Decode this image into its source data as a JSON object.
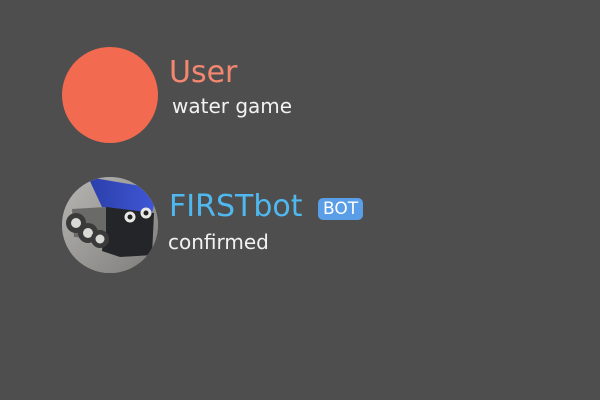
{
  "messages": [
    {
      "username": "User",
      "text": "water game",
      "avatar": "orange-circle",
      "color": "#f4876f"
    },
    {
      "username": "FIRSTbot",
      "badge": "BOT",
      "text": "confirmed",
      "avatar": "robot-photo",
      "color": "#4fb8ee"
    }
  ],
  "colors": {
    "background": "#4f4e4f",
    "user_avatar": "#f26a4f",
    "badge": "#5a9ee8"
  }
}
